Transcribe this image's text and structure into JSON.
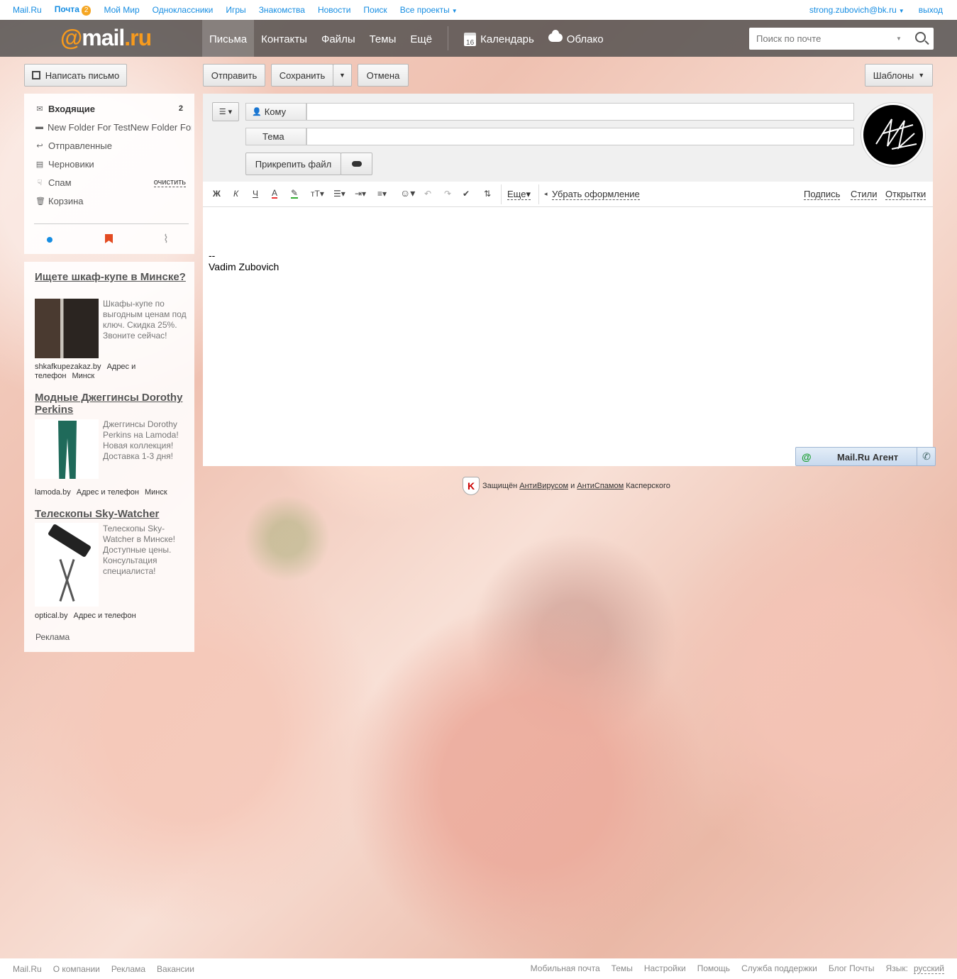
{
  "portal": {
    "links": [
      "Mail.Ru",
      "Почта",
      "Мой Мир",
      "Одноклассники",
      "Игры",
      "Знакомства",
      "Новости",
      "Поиск",
      "Все проекты"
    ],
    "mail_badge": "2",
    "user_email": "strong.zubovich@bk.ru",
    "logout": "выход"
  },
  "header": {
    "nav": [
      "Письма",
      "Контакты",
      "Файлы",
      "Темы",
      "Ещё"
    ],
    "calendar": "Календарь",
    "calendar_day": "16",
    "cloud": "Облако",
    "search_placeholder": "Поиск по почте"
  },
  "actions": {
    "compose": "Написать письмо",
    "send": "Отправить",
    "save": "Сохранить",
    "cancel": "Отмена",
    "templates": "Шаблоны"
  },
  "folders": [
    {
      "label": "Входящие",
      "count": "2"
    },
    {
      "label": "New Folder For TestNew Folder For Test"
    },
    {
      "label": "Отправленные"
    },
    {
      "label": "Черновики"
    },
    {
      "label": "Спам",
      "action": "очистить"
    },
    {
      "label": "Корзина"
    }
  ],
  "ads": [
    {
      "title": "Ищете шкаф-купе в Минске?",
      "text": "Шкафы-купе по выгодным ценам под ключ. Скидка 25%. Звоните сейчас!",
      "site": "shkafkupezakaz.by",
      "address": "Адрес и телефон",
      "city": "Минск"
    },
    {
      "title": "Модные Джеггинсы Dorothy Perkins",
      "text": "Джеггинсы Dorothy Perkins на Lamoda! Новая коллекция! Доставка 1-3 дня!",
      "site": "lamoda.by",
      "address": "Адрес и телефон",
      "city": "Минск"
    },
    {
      "title": "Телескопы Sky-Watcher",
      "text": "Телескопы Sky-Watcher в Минске! Доступные цены. Консультация специалиста!",
      "site": "optical.by",
      "address": "Адрес и телефон"
    }
  ],
  "ads_label": "Реклама",
  "compose": {
    "to_label": "Кому",
    "subject_label": "Тема",
    "attach": "Прикрепить файл",
    "toolbar": {
      "bold": "Ж",
      "italic": "К",
      "underline": "Ч",
      "more": "Еще",
      "remove_format": "Убрать оформление",
      "signature": "Подпись",
      "styles": "Стили",
      "cards": "Открытки"
    },
    "body_sep": "--",
    "body_name": "Vadim Zubovich"
  },
  "agent": "Mail.Ru Агент",
  "kaspersky": {
    "prefix": "Защищён",
    "av": "АнтиВирусом",
    "and": "и",
    "as": "АнтиСпамом",
    "suffix": "Касперского"
  },
  "footer": {
    "left": [
      "Mail.Ru",
      "О компании",
      "Реклама",
      "Вакансии"
    ],
    "right": [
      "Мобильная почта",
      "Темы",
      "Настройки",
      "Помощь",
      "Служба поддержки",
      "Блог Почты"
    ],
    "lang_label": "Язык:",
    "lang": "русский"
  }
}
